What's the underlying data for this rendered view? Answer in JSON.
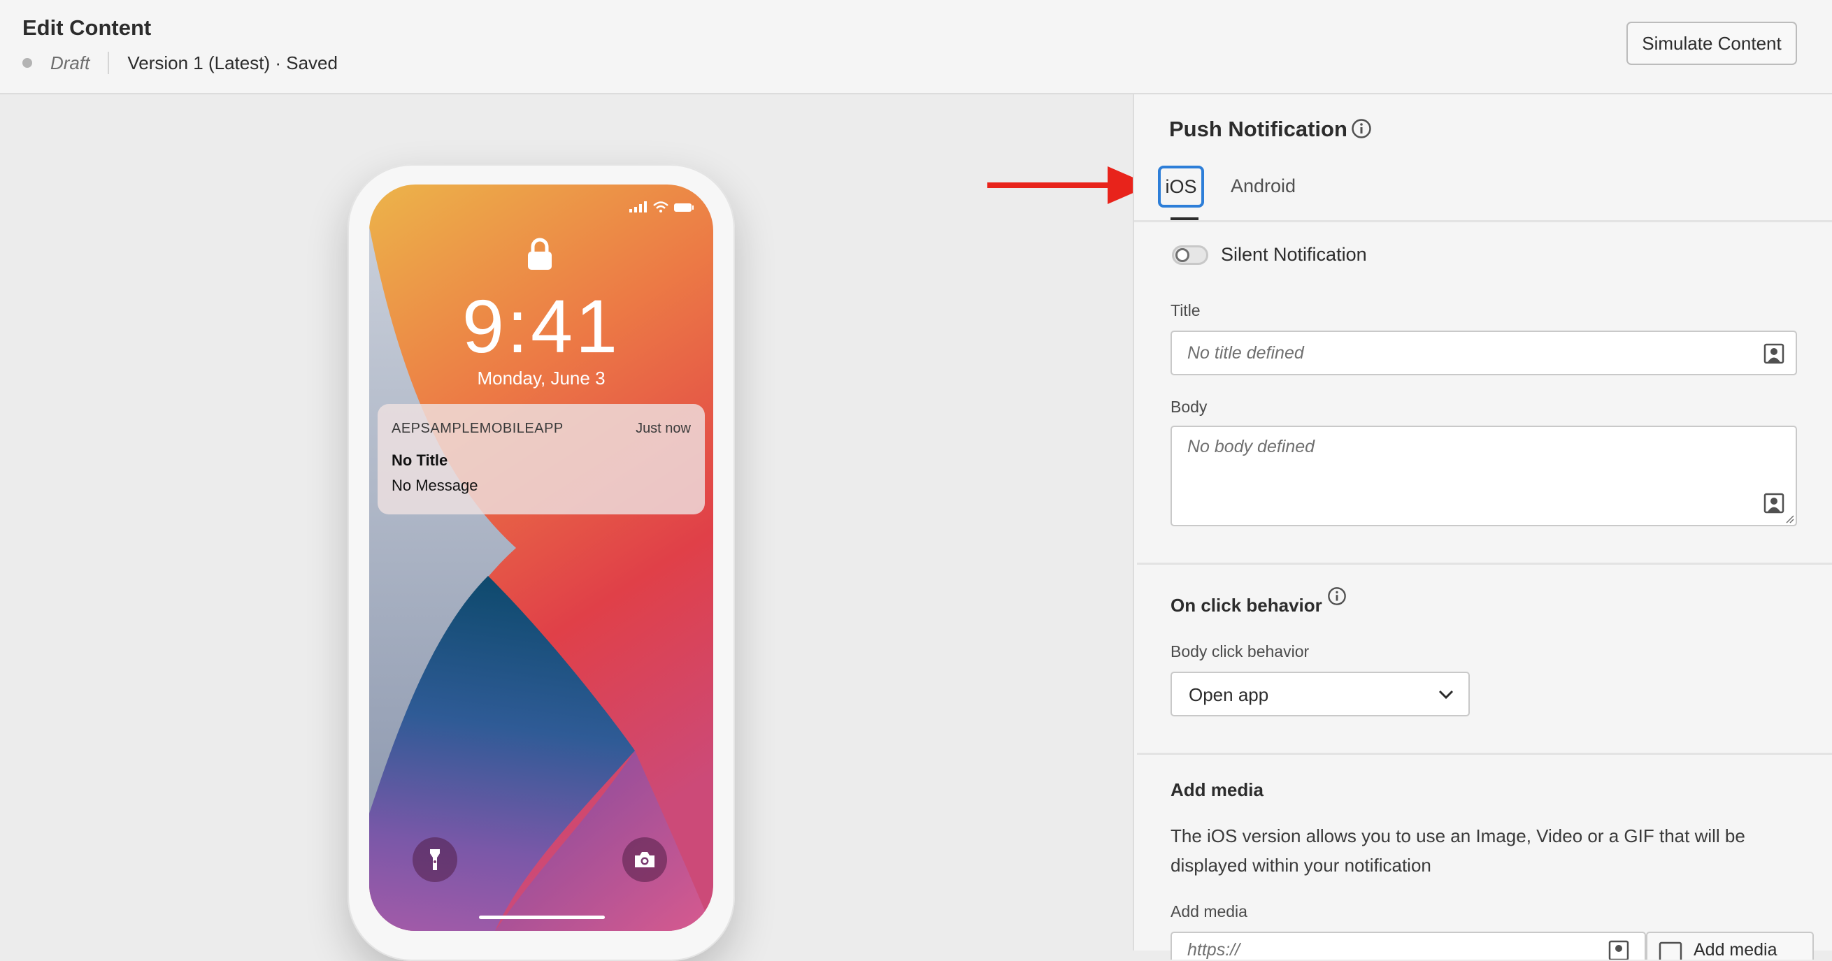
{
  "header": {
    "title": "Edit Content",
    "status": "Draft",
    "version": "Version 1 (Latest) · Saved",
    "simulate_label": "Simulate Content"
  },
  "phone": {
    "time": "9:41",
    "date": "Monday, June 3",
    "notification": {
      "app_name": "AEPSAMPLEMOBILEAPP",
      "timestamp": "Just now",
      "title": "No Title",
      "message": "No Message"
    },
    "icons": [
      "signal-icon",
      "wifi-icon",
      "battery-icon",
      "lock-icon",
      "flashlight-icon",
      "camera-icon"
    ]
  },
  "panel": {
    "title": "Push Notification",
    "tabs": [
      {
        "label": "iOS",
        "selected": true
      },
      {
        "label": "Android",
        "selected": false
      }
    ],
    "silent_label": "Silent Notification",
    "silent_on": false,
    "title_field": {
      "label": "Title",
      "placeholder": "No title defined"
    },
    "body_field": {
      "label": "Body",
      "placeholder": "No body defined"
    },
    "on_click": {
      "title": "On click behavior",
      "body_click_label": "Body click behavior",
      "body_click_value": "Open app"
    },
    "media": {
      "title": "Add media",
      "description": "The iOS version allows you to use an Image, Video or a GIF that will be displayed within your notification",
      "field_label": "Add media",
      "field_placeholder": "https://",
      "button_label": "Add media"
    }
  },
  "colors": {
    "accent": "#2d7ed8",
    "annotation_arrow": "#e8231b",
    "panel_bg": "#f5f5f5",
    "canvas_bg": "#ececec"
  }
}
